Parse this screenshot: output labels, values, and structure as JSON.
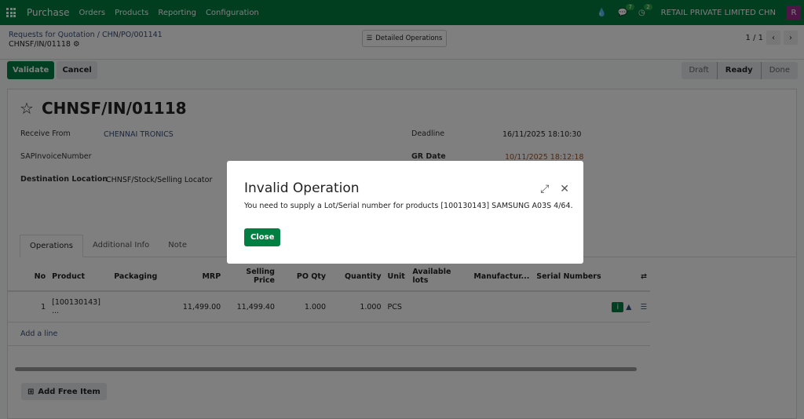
{
  "nav": {
    "app": "Purchase",
    "menus": [
      "Orders",
      "Products",
      "Reporting",
      "Configuration"
    ],
    "chat_count": "7",
    "activity_count": "2",
    "company": "RETAIL PRIVATE LIMITED CHN",
    "avatar": "R"
  },
  "breadcrumb": {
    "parent": "Requests for Quotation",
    "po": "CHN/PO/001141",
    "current": "CHNSF/IN/01118"
  },
  "detailed_operations": "Detailed Operations",
  "pager": "1 / 1",
  "buttons": {
    "validate": "Validate",
    "cancel": "Cancel"
  },
  "status": [
    "Draft",
    "Ready",
    "Done"
  ],
  "form": {
    "title": "CHNSF/IN/01118",
    "receive_from_label": "Receive From",
    "receive_from": "CHENNAI TRONICS",
    "sap_label": "SAPInvoiceNumber",
    "dest_label": "Destination Location",
    "dest": "CHNSF/Stock/Selling Locator",
    "deadline_label": "Deadline",
    "deadline": "16/11/2025 18:10:30",
    "gr_label": "GR Date",
    "gr": "10/11/2025 18:12:18"
  },
  "tabs": [
    "Operations",
    "Additional Info",
    "Note"
  ],
  "table": {
    "headers": [
      "No",
      "Product",
      "Packaging",
      "MRP",
      "Selling Price",
      "PO Qty",
      "Quantity",
      "Unit",
      "Available lots",
      "Manufactur...",
      "Serial Numbers"
    ],
    "rows": [
      [
        "1",
        "[100130143] ...",
        "",
        "11,499.00",
        "11,499.40",
        "1.000",
        "1.000",
        "PCS",
        "",
        "",
        ""
      ]
    ],
    "add_line": "Add a line"
  },
  "add_free_item": "Add Free Item",
  "modal": {
    "title": "Invalid Operation",
    "message": "You need to supply a Lot/Serial number for products [100130143] SAMSUNG A03S 4/64.",
    "close": "Close"
  }
}
